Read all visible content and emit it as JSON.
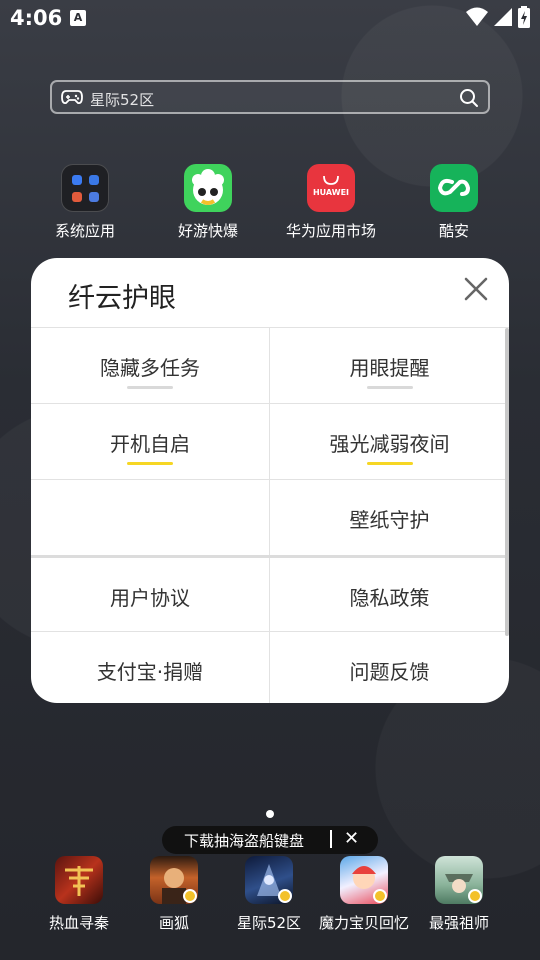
{
  "status_bar": {
    "time": "4:06",
    "notification_icon": "A"
  },
  "search": {
    "placeholder": "星际52区"
  },
  "top_apps": [
    {
      "label": "系统应用",
      "icon": "folder-icon"
    },
    {
      "label": "好游快爆",
      "icon": "haoyou-icon"
    },
    {
      "label": "华为应用市场",
      "icon": "huawei-appgallery-icon",
      "icon_text": "HUAWEI"
    },
    {
      "label": "酷安",
      "icon": "coolapk-icon"
    }
  ],
  "panel": {
    "title": "纤云护眼",
    "rows": [
      {
        "left": "隐藏多任务",
        "right": "用眼提醒"
      },
      {
        "left": "开机自启",
        "right": "强光减弱夜间"
      },
      {
        "left": "",
        "right": "壁纸守护"
      },
      {
        "left": "用户协议",
        "right": "隐私政策"
      },
      {
        "left": "支付宝·捐赠",
        "right": "问题反馈"
      }
    ]
  },
  "toast": {
    "message": "下载抽海盗船键盘",
    "close": "✕"
  },
  "dock_apps": [
    {
      "label": "热血寻秦",
      "icon": "rexue-xunqin-icon"
    },
    {
      "label": "画狐",
      "icon": "huahu-icon"
    },
    {
      "label": "星际52区",
      "icon": "xingji52-icon"
    },
    {
      "label": "魔力宝贝回忆",
      "icon": "moli-baobei-icon"
    },
    {
      "label": "最强祖师",
      "icon": "zuiqiang-zushi-icon"
    }
  ],
  "colors": {
    "accent_yellow": "#f6d623",
    "inactive_bar": "#d9d9d9",
    "panel_bg": "#ffffff"
  }
}
